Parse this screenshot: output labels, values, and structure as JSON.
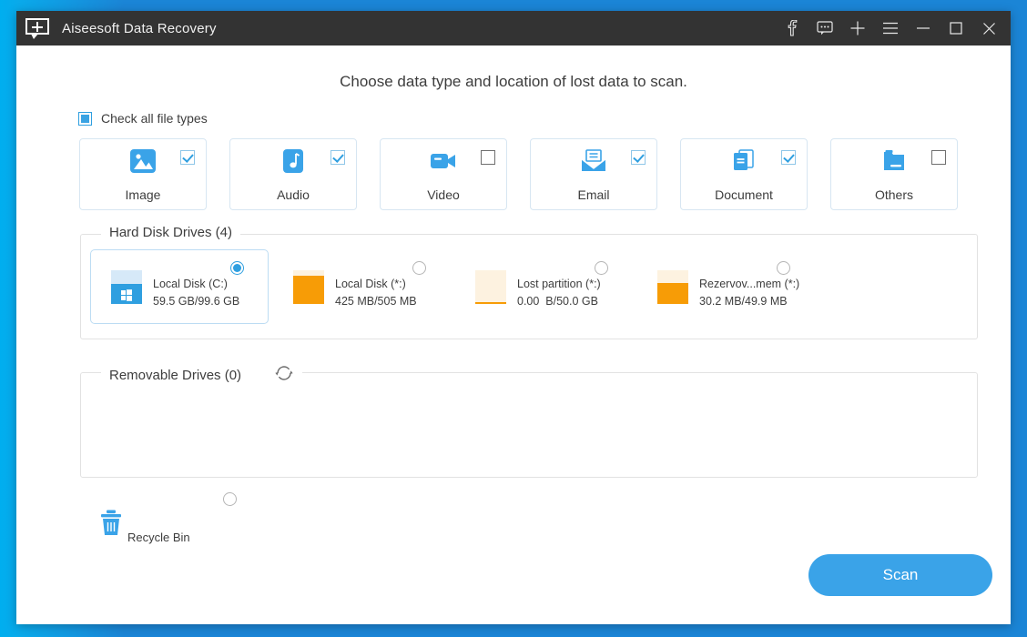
{
  "window": {
    "app_title": "Aiseesoft Data Recovery",
    "logo_icon": "speech-bubble-plus-icon",
    "controls": [
      {
        "name": "facebook-button",
        "glyph": "f"
      },
      {
        "name": "feedback-button",
        "glyph": "speech-bubble-icon"
      },
      {
        "name": "add-button",
        "glyph": "plus-icon"
      },
      {
        "name": "menu-button",
        "glyph": "hamburger-icon"
      },
      {
        "name": "minimize-button",
        "glyph": "minimize-icon"
      },
      {
        "name": "maximize-button",
        "glyph": "maximize-icon"
      },
      {
        "name": "close-button",
        "glyph": "close-icon"
      }
    ]
  },
  "main": {
    "headline": "Choose data type and location of lost data to scan.",
    "check_all_label": "Check all file types",
    "check_all_state": "indeterminate",
    "file_types": [
      {
        "label": "Image",
        "icon": "image-icon",
        "checked": true
      },
      {
        "label": "Audio",
        "icon": "audio-icon",
        "checked": true
      },
      {
        "label": "Video",
        "icon": "video-icon",
        "checked": false
      },
      {
        "label": "Email",
        "icon": "email-icon",
        "checked": true
      },
      {
        "label": "Document",
        "icon": "document-icon",
        "checked": true
      },
      {
        "label": "Others",
        "icon": "others-folder-icon",
        "checked": false
      }
    ],
    "hard_disk": {
      "legend": "Hard Disk Drives (4)",
      "drives": [
        {
          "name": "Local Disk (C:)",
          "size": "59.5 GB/99.6 GB",
          "icon": "windows-drive-icon",
          "selected": true,
          "fill": 60,
          "color": "#2f9fe0"
        },
        {
          "name": "Local Disk (*:)",
          "size": "425 MB/505 MB",
          "icon": "drive-icon",
          "selected": false,
          "fill": 84,
          "color": "#f79c06"
        },
        {
          "name": "Lost partition (*:)",
          "size": "0.00  B/50.0 GB",
          "icon": "drive-icon",
          "selected": false,
          "fill": 4,
          "color": "#f79c06"
        },
        {
          "name": "Rezervov...mem (*:)",
          "size": "30.2 MB/49.9 MB",
          "icon": "drive-icon",
          "selected": false,
          "fill": 61,
          "color": "#f79c06"
        }
      ]
    },
    "removable": {
      "legend": "Removable Drives (0)",
      "refresh_icon": "refresh-icon",
      "drives": []
    },
    "recycle_bin": {
      "label": "Recycle Bin",
      "icon": "recycle-bin-icon",
      "selected": false
    },
    "scan_label": "Scan"
  },
  "colors": {
    "accent": "#3aa3e8",
    "titlebar": "#333333",
    "orange": "#f79c06",
    "desktop": "#1b85d6"
  }
}
